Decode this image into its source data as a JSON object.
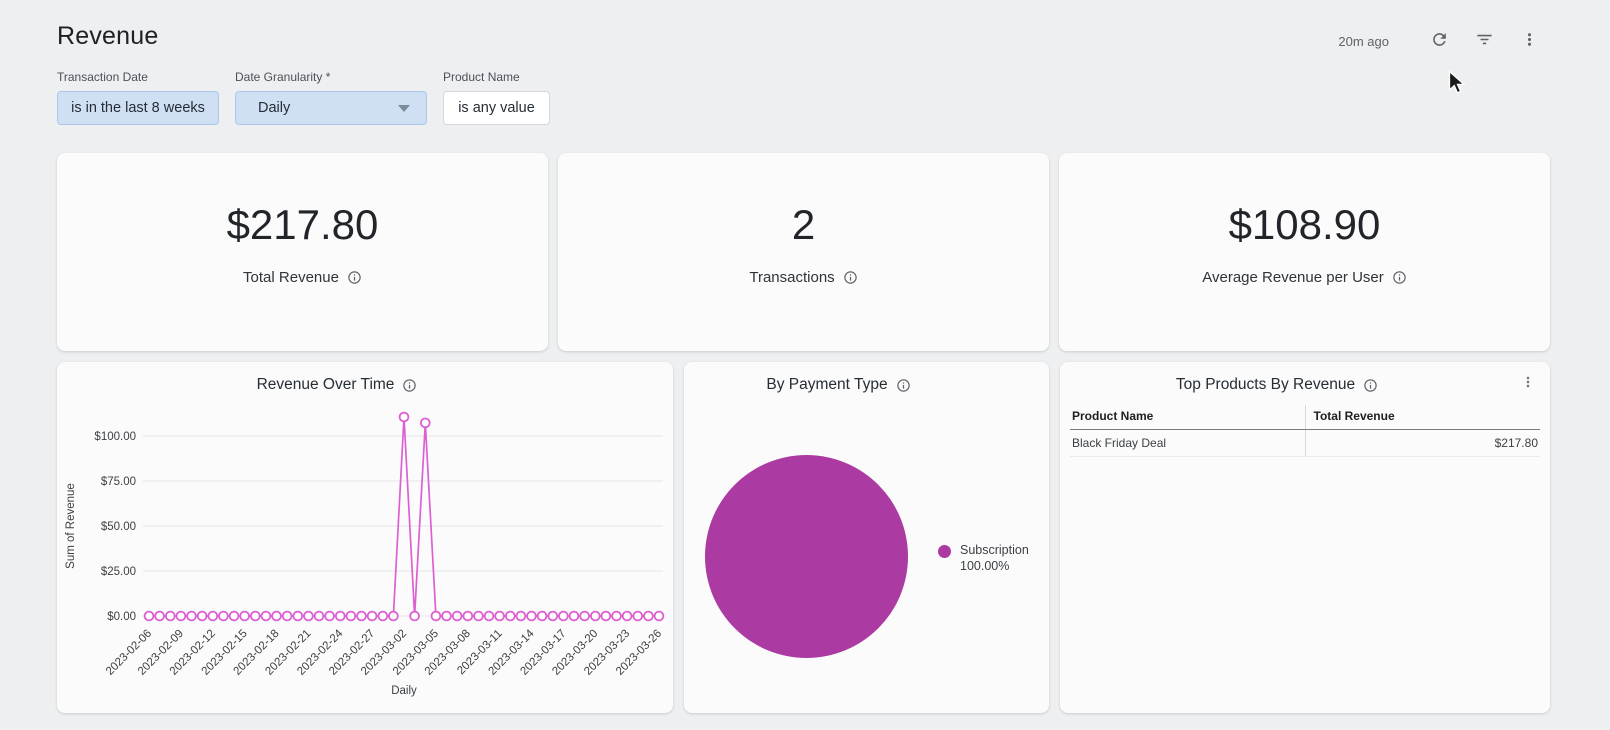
{
  "header": {
    "title": "Revenue",
    "last_updated": "20m ago",
    "action_icons": [
      "refresh-icon",
      "filter-icon",
      "kebab-menu-icon"
    ]
  },
  "filters": [
    {
      "label": "Transaction Date",
      "value": "is in the last 8 weeks"
    },
    {
      "label": "Date Granularity *",
      "value": "Daily"
    },
    {
      "label": "Product Name",
      "value": "is any value"
    }
  ],
  "kpis": [
    {
      "value": "$217.80",
      "label": "Total Revenue"
    },
    {
      "value": "2",
      "label": "Transactions"
    },
    {
      "value": "$108.90",
      "label": "Average Revenue per User"
    }
  ],
  "colors": {
    "line_series": "#DD5FD1",
    "pie_series": "#AB3BA3",
    "page_bg": "#edeff1",
    "card_bg": "#fbfbfc",
    "chip_blue": "#cfe0f5",
    "grid": "#e4e6e9"
  },
  "chart_data": [
    {
      "type": "line",
      "title": "Revenue Over Time",
      "xlabel": "Daily",
      "ylabel": "Sum of Revenue",
      "series_name": "Sum of Revenue",
      "series_color": "#DD5FD1",
      "x": [
        "2023-02-06",
        "2023-02-07",
        "2023-02-08",
        "2023-02-09",
        "2023-02-10",
        "2023-02-11",
        "2023-02-12",
        "2023-02-13",
        "2023-02-14",
        "2023-02-15",
        "2023-02-16",
        "2023-02-17",
        "2023-02-18",
        "2023-02-19",
        "2023-02-20",
        "2023-02-21",
        "2023-02-22",
        "2023-02-23",
        "2023-02-24",
        "2023-02-25",
        "2023-02-26",
        "2023-02-27",
        "2023-02-28",
        "2023-03-01",
        "2023-03-02",
        "2023-03-03",
        "2023-03-04",
        "2023-03-05",
        "2023-03-06",
        "2023-03-07",
        "2023-03-08",
        "2023-03-09",
        "2023-03-10",
        "2023-03-11",
        "2023-03-12",
        "2023-03-13",
        "2023-03-14",
        "2023-03-15",
        "2023-03-16",
        "2023-03-17",
        "2023-03-18",
        "2023-03-19",
        "2023-03-20",
        "2023-03-21",
        "2023-03-22",
        "2023-03-23",
        "2023-03-24",
        "2023-03-25",
        "2023-03-26"
      ],
      "y": [
        0,
        0,
        0,
        0,
        0,
        0,
        0,
        0,
        0,
        0,
        0,
        0,
        0,
        0,
        0,
        0,
        0,
        0,
        0,
        0,
        0,
        0,
        0,
        0,
        110.55,
        0,
        107.25,
        0,
        0,
        0,
        0,
        0,
        0,
        0,
        0,
        0,
        0,
        0,
        0,
        0,
        0,
        0,
        0,
        0,
        0,
        0,
        0,
        0,
        0
      ],
      "x_tick_every": 3,
      "y_ticks": [
        0,
        25,
        50,
        75,
        100
      ],
      "y_tick_labels": [
        "$0.00",
        "$25.00",
        "$50.00",
        "$75.00",
        "$100.00"
      ],
      "ylim": [
        0,
        115
      ],
      "grid": true,
      "markers": "open-circle"
    },
    {
      "type": "pie",
      "title": "By Payment Type",
      "legend_position": "right",
      "slices": [
        {
          "label": "Subscription",
          "pct": "100.00%",
          "value": 100,
          "color": "#AB3BA3"
        }
      ]
    },
    {
      "type": "table",
      "title": "Top Products By Revenue",
      "columns": [
        "Product Name",
        "Total Revenue"
      ],
      "rows": [
        [
          "Black Friday Deal",
          "$217.80"
        ]
      ]
    }
  ]
}
